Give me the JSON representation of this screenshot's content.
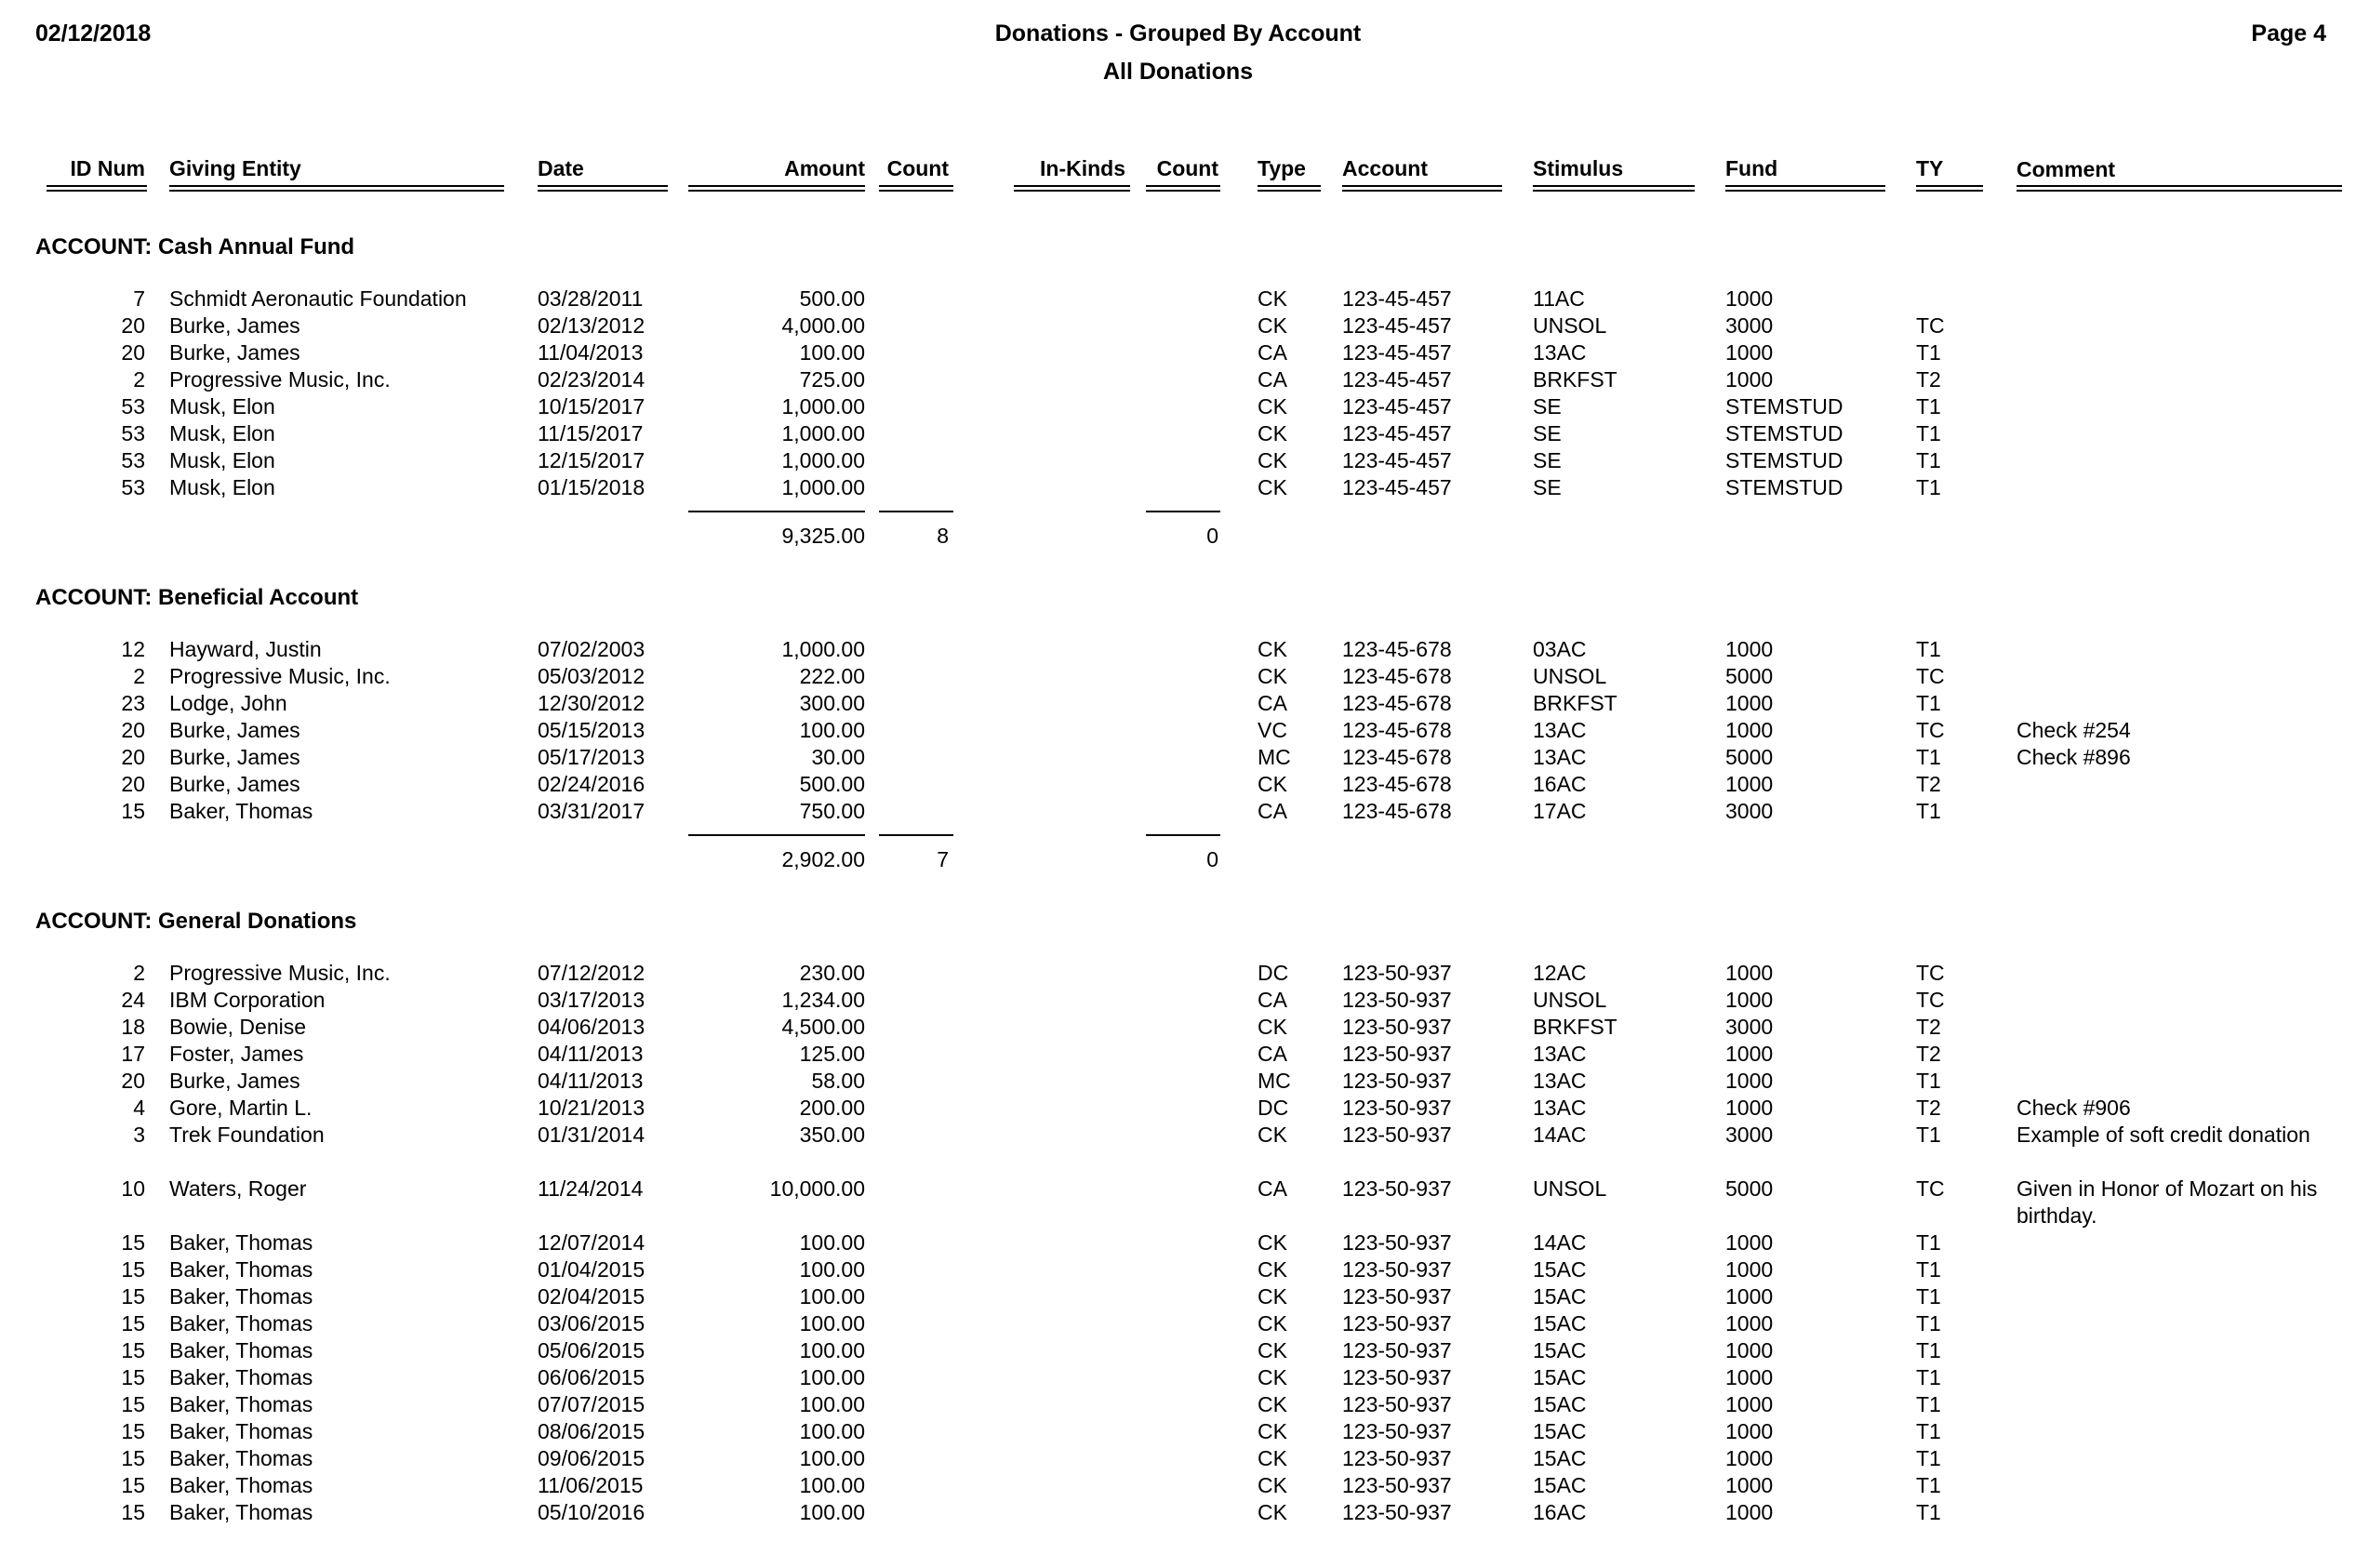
{
  "header": {
    "date": "02/12/2018",
    "title": "Donations - Grouped By Account",
    "subtitle": "All Donations",
    "page": "Page 4"
  },
  "columns": {
    "id_num": "ID Num",
    "giving_entity": "Giving Entity",
    "date": "Date",
    "amount": "Amount",
    "count": "Count",
    "in_kinds": "In-Kinds",
    "count2": "Count",
    "type": "Type",
    "account": "Account",
    "stimulus": "Stimulus",
    "fund": "Fund",
    "ty": "TY",
    "comment": "Comment"
  },
  "groups": [
    {
      "label": "ACCOUNT: Cash Annual Fund",
      "rows": [
        {
          "id_num": "7",
          "entity": "Schmidt Aeronautic Foundation",
          "date": "03/28/2011",
          "amount": "500.00",
          "count": "",
          "in_kinds": "",
          "count2": "",
          "type": "CK",
          "account": "123-45-457",
          "stimulus": "11AC",
          "fund": "1000",
          "ty": "",
          "comment": ""
        },
        {
          "id_num": "20",
          "entity": "Burke, James",
          "date": "02/13/2012",
          "amount": "4,000.00",
          "count": "",
          "in_kinds": "",
          "count2": "",
          "type": "CK",
          "account": "123-45-457",
          "stimulus": "UNSOL",
          "fund": "3000",
          "ty": "TC",
          "comment": ""
        },
        {
          "id_num": "20",
          "entity": "Burke, James",
          "date": "11/04/2013",
          "amount": "100.00",
          "count": "",
          "in_kinds": "",
          "count2": "",
          "type": "CA",
          "account": "123-45-457",
          "stimulus": "13AC",
          "fund": "1000",
          "ty": "T1",
          "comment": ""
        },
        {
          "id_num": "2",
          "entity": "Progressive Music, Inc.",
          "date": "02/23/2014",
          "amount": "725.00",
          "count": "",
          "in_kinds": "",
          "count2": "",
          "type": "CA",
          "account": "123-45-457",
          "stimulus": "BRKFST",
          "fund": "1000",
          "ty": "T2",
          "comment": ""
        },
        {
          "id_num": "53",
          "entity": "Musk, Elon",
          "date": "10/15/2017",
          "amount": "1,000.00",
          "count": "",
          "in_kinds": "",
          "count2": "",
          "type": "CK",
          "account": "123-45-457",
          "stimulus": "SE",
          "fund": "STEMSTUD",
          "ty": "T1",
          "comment": ""
        },
        {
          "id_num": "53",
          "entity": "Musk, Elon",
          "date": "11/15/2017",
          "amount": "1,000.00",
          "count": "",
          "in_kinds": "",
          "count2": "",
          "type": "CK",
          "account": "123-45-457",
          "stimulus": "SE",
          "fund": "STEMSTUD",
          "ty": "T1",
          "comment": ""
        },
        {
          "id_num": "53",
          "entity": "Musk, Elon",
          "date": "12/15/2017",
          "amount": "1,000.00",
          "count": "",
          "in_kinds": "",
          "count2": "",
          "type": "CK",
          "account": "123-45-457",
          "stimulus": "SE",
          "fund": "STEMSTUD",
          "ty": "T1",
          "comment": ""
        },
        {
          "id_num": "53",
          "entity": "Musk, Elon",
          "date": "01/15/2018",
          "amount": "1,000.00",
          "count": "",
          "in_kinds": "",
          "count2": "",
          "type": "CK",
          "account": "123-45-457",
          "stimulus": "SE",
          "fund": "STEMSTUD",
          "ty": "T1",
          "comment": ""
        }
      ],
      "subtotal": {
        "amount": "9,325.00",
        "count": "8",
        "in_kinds": "",
        "count2": "0"
      }
    },
    {
      "label": "ACCOUNT: Beneficial Account",
      "rows": [
        {
          "id_num": "12",
          "entity": "Hayward, Justin",
          "date": "07/02/2003",
          "amount": "1,000.00",
          "count": "",
          "in_kinds": "",
          "count2": "",
          "type": "CK",
          "account": "123-45-678",
          "stimulus": "03AC",
          "fund": "1000",
          "ty": "T1",
          "comment": ""
        },
        {
          "id_num": "2",
          "entity": "Progressive Music, Inc.",
          "date": "05/03/2012",
          "amount": "222.00",
          "count": "",
          "in_kinds": "",
          "count2": "",
          "type": "CK",
          "account": "123-45-678",
          "stimulus": "UNSOL",
          "fund": "5000",
          "ty": "TC",
          "comment": ""
        },
        {
          "id_num": "23",
          "entity": "Lodge, John",
          "date": "12/30/2012",
          "amount": "300.00",
          "count": "",
          "in_kinds": "",
          "count2": "",
          "type": "CA",
          "account": "123-45-678",
          "stimulus": "BRKFST",
          "fund": "1000",
          "ty": "T1",
          "comment": ""
        },
        {
          "id_num": "20",
          "entity": "Burke, James",
          "date": "05/15/2013",
          "amount": "100.00",
          "count": "",
          "in_kinds": "",
          "count2": "",
          "type": "VC",
          "account": "123-45-678",
          "stimulus": "13AC",
          "fund": "1000",
          "ty": "TC",
          "comment": "Check #254"
        },
        {
          "id_num": "20",
          "entity": "Burke, James",
          "date": "05/17/2013",
          "amount": "30.00",
          "count": "",
          "in_kinds": "",
          "count2": "",
          "type": "MC",
          "account": "123-45-678",
          "stimulus": "13AC",
          "fund": "5000",
          "ty": "T1",
          "comment": "Check #896"
        },
        {
          "id_num": "20",
          "entity": "Burke, James",
          "date": "02/24/2016",
          "amount": "500.00",
          "count": "",
          "in_kinds": "",
          "count2": "",
          "type": "CK",
          "account": "123-45-678",
          "stimulus": "16AC",
          "fund": "1000",
          "ty": "T2",
          "comment": ""
        },
        {
          "id_num": "15",
          "entity": "Baker, Thomas",
          "date": "03/31/2017",
          "amount": "750.00",
          "count": "",
          "in_kinds": "",
          "count2": "",
          "type": "CA",
          "account": "123-45-678",
          "stimulus": "17AC",
          "fund": "3000",
          "ty": "T1",
          "comment": ""
        }
      ],
      "subtotal": {
        "amount": "2,902.00",
        "count": "7",
        "in_kinds": "",
        "count2": "0"
      }
    },
    {
      "label": "ACCOUNT: General Donations",
      "rows": [
        {
          "id_num": "2",
          "entity": "Progressive Music, Inc.",
          "date": "07/12/2012",
          "amount": "230.00",
          "count": "",
          "in_kinds": "",
          "count2": "",
          "type": "DC",
          "account": "123-50-937",
          "stimulus": "12AC",
          "fund": "1000",
          "ty": "TC",
          "comment": ""
        },
        {
          "id_num": "24",
          "entity": "IBM Corporation",
          "date": "03/17/2013",
          "amount": "1,234.00",
          "count": "",
          "in_kinds": "",
          "count2": "",
          "type": "CA",
          "account": "123-50-937",
          "stimulus": "UNSOL",
          "fund": "1000",
          "ty": "TC",
          "comment": ""
        },
        {
          "id_num": "18",
          "entity": "Bowie, Denise",
          "date": "04/06/2013",
          "amount": "4,500.00",
          "count": "",
          "in_kinds": "",
          "count2": "",
          "type": "CK",
          "account": "123-50-937",
          "stimulus": "BRKFST",
          "fund": "3000",
          "ty": "T2",
          "comment": ""
        },
        {
          "id_num": "17",
          "entity": "Foster, James",
          "date": "04/11/2013",
          "amount": "125.00",
          "count": "",
          "in_kinds": "",
          "count2": "",
          "type": "CA",
          "account": "123-50-937",
          "stimulus": "13AC",
          "fund": "1000",
          "ty": "T2",
          "comment": ""
        },
        {
          "id_num": "20",
          "entity": "Burke, James",
          "date": "04/11/2013",
          "amount": "58.00",
          "count": "",
          "in_kinds": "",
          "count2": "",
          "type": "MC",
          "account": "123-50-937",
          "stimulus": "13AC",
          "fund": "1000",
          "ty": "T1",
          "comment": ""
        },
        {
          "id_num": "4",
          "entity": "Gore, Martin L.",
          "date": "10/21/2013",
          "amount": "200.00",
          "count": "",
          "in_kinds": "",
          "count2": "",
          "type": "DC",
          "account": "123-50-937",
          "stimulus": "13AC",
          "fund": "1000",
          "ty": "T2",
          "comment": "Check #906"
        },
        {
          "id_num": "3",
          "entity": "Trek Foundation",
          "date": "01/31/2014",
          "amount": "350.00",
          "count": "",
          "in_kinds": "",
          "count2": "",
          "type": "CK",
          "account": "123-50-937",
          "stimulus": "14AC",
          "fund": "3000",
          "ty": "T1",
          "comment": "Example of soft credit donation"
        },
        {
          "id_num": "10",
          "entity": "Waters, Roger",
          "date": "11/24/2014",
          "amount": "10,000.00",
          "count": "",
          "in_kinds": "",
          "count2": "",
          "type": "CA",
          "account": "123-50-937",
          "stimulus": "UNSOL",
          "fund": "5000",
          "ty": "TC",
          "comment": "Given in Honor of Mozart on his birthday."
        },
        {
          "id_num": "15",
          "entity": "Baker, Thomas",
          "date": "12/07/2014",
          "amount": "100.00",
          "count": "",
          "in_kinds": "",
          "count2": "",
          "type": "CK",
          "account": "123-50-937",
          "stimulus": "14AC",
          "fund": "1000",
          "ty": "T1",
          "comment": ""
        },
        {
          "id_num": "15",
          "entity": "Baker, Thomas",
          "date": "01/04/2015",
          "amount": "100.00",
          "count": "",
          "in_kinds": "",
          "count2": "",
          "type": "CK",
          "account": "123-50-937",
          "stimulus": "15AC",
          "fund": "1000",
          "ty": "T1",
          "comment": ""
        },
        {
          "id_num": "15",
          "entity": "Baker, Thomas",
          "date": "02/04/2015",
          "amount": "100.00",
          "count": "",
          "in_kinds": "",
          "count2": "",
          "type": "CK",
          "account": "123-50-937",
          "stimulus": "15AC",
          "fund": "1000",
          "ty": "T1",
          "comment": ""
        },
        {
          "id_num": "15",
          "entity": "Baker, Thomas",
          "date": "03/06/2015",
          "amount": "100.00",
          "count": "",
          "in_kinds": "",
          "count2": "",
          "type": "CK",
          "account": "123-50-937",
          "stimulus": "15AC",
          "fund": "1000",
          "ty": "T1",
          "comment": ""
        },
        {
          "id_num": "15",
          "entity": "Baker, Thomas",
          "date": "05/06/2015",
          "amount": "100.00",
          "count": "",
          "in_kinds": "",
          "count2": "",
          "type": "CK",
          "account": "123-50-937",
          "stimulus": "15AC",
          "fund": "1000",
          "ty": "T1",
          "comment": ""
        },
        {
          "id_num": "15",
          "entity": "Baker, Thomas",
          "date": "06/06/2015",
          "amount": "100.00",
          "count": "",
          "in_kinds": "",
          "count2": "",
          "type": "CK",
          "account": "123-50-937",
          "stimulus": "15AC",
          "fund": "1000",
          "ty": "T1",
          "comment": ""
        },
        {
          "id_num": "15",
          "entity": "Baker, Thomas",
          "date": "07/07/2015",
          "amount": "100.00",
          "count": "",
          "in_kinds": "",
          "count2": "",
          "type": "CK",
          "account": "123-50-937",
          "stimulus": "15AC",
          "fund": "1000",
          "ty": "T1",
          "comment": ""
        },
        {
          "id_num": "15",
          "entity": "Baker, Thomas",
          "date": "08/06/2015",
          "amount": "100.00",
          "count": "",
          "in_kinds": "",
          "count2": "",
          "type": "CK",
          "account": "123-50-937",
          "stimulus": "15AC",
          "fund": "1000",
          "ty": "T1",
          "comment": ""
        },
        {
          "id_num": "15",
          "entity": "Baker, Thomas",
          "date": "09/06/2015",
          "amount": "100.00",
          "count": "",
          "in_kinds": "",
          "count2": "",
          "type": "CK",
          "account": "123-50-937",
          "stimulus": "15AC",
          "fund": "1000",
          "ty": "T1",
          "comment": ""
        },
        {
          "id_num": "15",
          "entity": "Baker, Thomas",
          "date": "11/06/2015",
          "amount": "100.00",
          "count": "",
          "in_kinds": "",
          "count2": "",
          "type": "CK",
          "account": "123-50-937",
          "stimulus": "15AC",
          "fund": "1000",
          "ty": "T1",
          "comment": ""
        },
        {
          "id_num": "15",
          "entity": "Baker, Thomas",
          "date": "05/10/2016",
          "amount": "100.00",
          "count": "",
          "in_kinds": "",
          "count2": "",
          "type": "CK",
          "account": "123-50-937",
          "stimulus": "16AC",
          "fund": "1000",
          "ty": "T1",
          "comment": ""
        }
      ],
      "subtotal": null
    }
  ]
}
